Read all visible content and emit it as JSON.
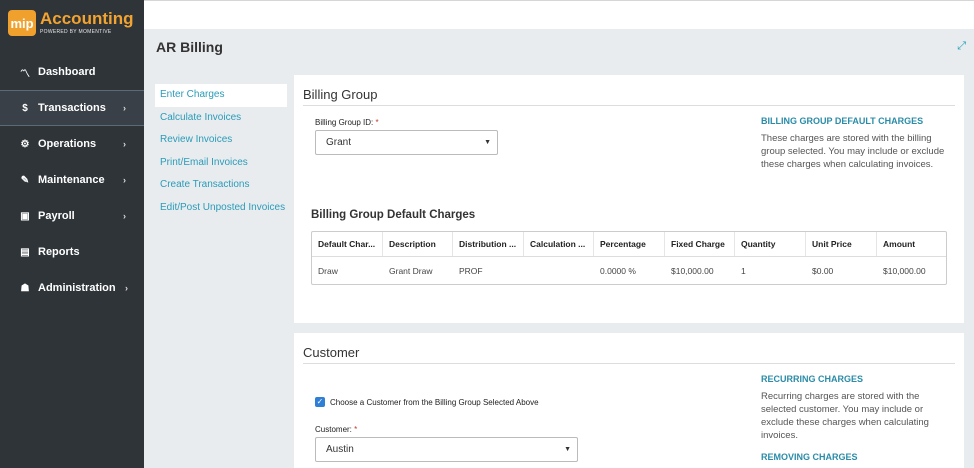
{
  "brand": {
    "badge": "mip",
    "title": "Accounting",
    "subtitle": "POWERED BY MOMENTIVE"
  },
  "sidebar": {
    "items": [
      {
        "label": "Dashboard",
        "icon": "chart-line-icon",
        "glyph": "📈"
      },
      {
        "label": "Transactions",
        "icon": "dollar-icon",
        "glyph": "$"
      },
      {
        "label": "Operations",
        "icon": "gears-icon",
        "glyph": "⚙"
      },
      {
        "label": "Maintenance",
        "icon": "wrench-icon",
        "glyph": "🔧"
      },
      {
        "label": "Payroll",
        "icon": "money-icon",
        "glyph": "▣"
      },
      {
        "label": "Reports",
        "icon": "document-icon",
        "glyph": "▤"
      },
      {
        "label": "Administration",
        "icon": "users-icon",
        "glyph": "👥"
      }
    ]
  },
  "header": {
    "title": "AR Billing"
  },
  "subnav": {
    "items": [
      {
        "label": "Enter Charges"
      },
      {
        "label": "Calculate Invoices"
      },
      {
        "label": "Review Invoices"
      },
      {
        "label": "Print/Email Invoices"
      },
      {
        "label": "Create Transactions"
      },
      {
        "label": "Edit/Post Unposted Invoices"
      }
    ]
  },
  "billing_group": {
    "title": "Billing Group",
    "id_label": "Billing Group ID:",
    "required_mark": "*",
    "id_value": "Grant",
    "info_heading": "BILLING GROUP DEFAULT CHARGES",
    "info_text": "These charges are stored with the billing group selected. You may include or exclude these charges when calculating invoices.",
    "table_title": "Billing Group Default Charges",
    "columns": [
      "Default Char...",
      "Description",
      "Distribution ...",
      "Calculation ...",
      "Percentage",
      "Fixed Charge",
      "Quantity",
      "Unit Price",
      "Amount"
    ],
    "rows": [
      [
        "Draw",
        "Grant Draw",
        "PROF",
        "",
        "0.0000 %",
        "$10,000.00",
        "1",
        "$0.00",
        "$10,000.00"
      ]
    ]
  },
  "customer": {
    "title": "Customer",
    "checkbox_label": "Choose a Customer from the Billing Group Selected Above",
    "customer_label": "Customer:",
    "required_mark": "*",
    "customer_value": "Austin",
    "recurring_heading": "RECURRING CHARGES",
    "recurring_text": "Recurring charges are stored with the selected customer. You may include or exclude these charges when calculating invoices.",
    "removing_heading": "REMOVING CHARGES"
  },
  "colors": {
    "accent": "#2a9bb8",
    "sidebar": "#2f3439",
    "brand": "#f0a02c"
  }
}
